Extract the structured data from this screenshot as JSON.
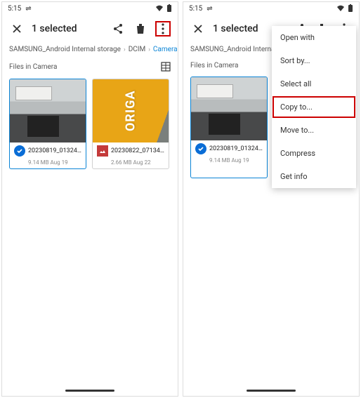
{
  "status": {
    "time": "5:15",
    "usb": "⇌"
  },
  "topbar": {
    "title": "1 selected"
  },
  "breadcrumb": {
    "root": "SAMSUNG_Android Internal storage",
    "mid": "DCIM",
    "leaf": "Camera",
    "root_trunc": "SAMSUNG_Android Internal stora"
  },
  "section": {
    "label": "Files in Camera"
  },
  "file1": {
    "name": "20230819_013240...",
    "meta": "9.14 MB  Aug 19"
  },
  "file2": {
    "name": "20230822_07134...",
    "meta": "2.66 MB  Aug 22",
    "thumb_text": "ORIGA",
    "meta_ghost": "2.66 MB  Aug 22"
  },
  "menu": {
    "open": "Open with",
    "sort": "Sort by...",
    "selectall": "Select all",
    "copy": "Copy to...",
    "move": "Move to...",
    "compress": "Compress",
    "info": "Get info"
  }
}
